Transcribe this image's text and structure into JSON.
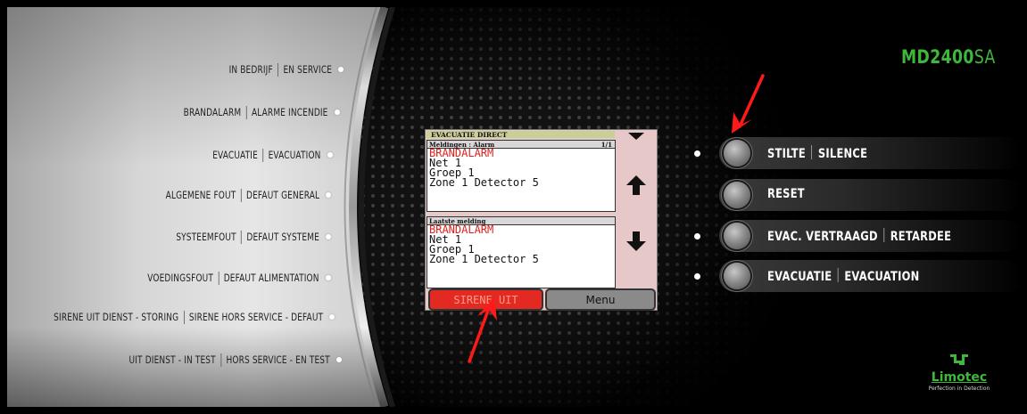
{
  "brand": {
    "model": "MD2400",
    "suffix": "SA"
  },
  "status_indicators": [
    {
      "nl": "IN BEDRIJF",
      "fr": "EN SERVICE"
    },
    {
      "nl": "BRANDALARM",
      "fr": "ALARME INCENDIE"
    },
    {
      "nl": "EVACUATIE",
      "fr": "EVACUATION"
    },
    {
      "nl": "ALGEMENE FOUT",
      "fr": "DEFAUT GENERAL"
    },
    {
      "nl": "SYSTEEMFOUT",
      "fr": "DEFAUT SYSTEME"
    },
    {
      "nl": "VOEDINGSFOUT",
      "fr": "DEFAUT ALIMENTATION"
    },
    {
      "nl": "SIRENE UIT DIENST - STORING",
      "fr": "SIRENE HORS SERVICE - DEFAUT"
    },
    {
      "nl": "UIT DIENST - IN TEST",
      "fr": "HORS SERVICE - EN TEST"
    }
  ],
  "lcd": {
    "title": "EVACUATIE DIRECT",
    "box1": {
      "header": "Meldingen : Alarm",
      "page": "1/1",
      "lines": [
        "BRANDALARM",
        "Net 1",
        "Groep 1",
        "Zone 1 Detector 5"
      ]
    },
    "box2": {
      "header": "Laatste melding",
      "lines": [
        "BRANDALARM",
        "Net 1",
        "Groep 1",
        "Zone 1 Detector 5"
      ]
    },
    "buttons": {
      "sirene": "SIRENE UIT",
      "menu": "Menu"
    }
  },
  "controls": [
    {
      "nl": "STILTE",
      "fr": "SILENCE",
      "led": true
    },
    {
      "nl": "RESET",
      "fr": "",
      "led": false
    },
    {
      "nl": "EVAC. VERTRAAGD",
      "fr": "RETARDEE",
      "led": true
    },
    {
      "nl": "EVACUATIE",
      "fr": "EVACUATION",
      "led": true
    }
  ],
  "logo": {
    "name": "Limotec",
    "tagline": "Perfection in Detection"
  },
  "colors": {
    "brand_green": "#3eb83b",
    "alarm_red": "#e0201c",
    "sirene_button": "#e32a22",
    "annotation_arrow": "#ff1a1a"
  }
}
